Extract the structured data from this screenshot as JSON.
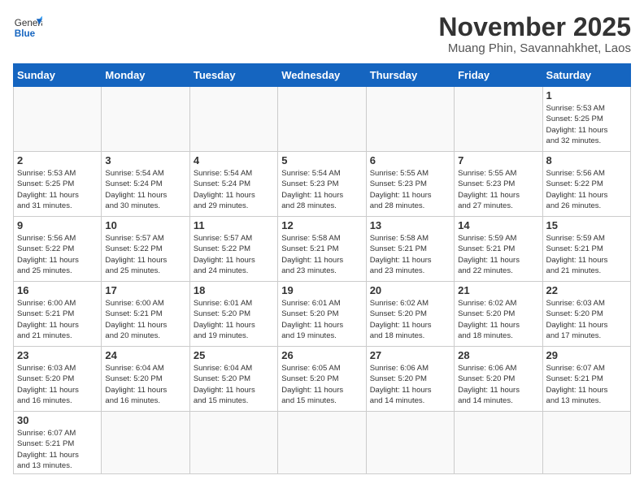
{
  "header": {
    "logo_general": "General",
    "logo_blue": "Blue",
    "month_title": "November 2025",
    "location": "Muang Phin, Savannahkhet, Laos"
  },
  "weekdays": [
    "Sunday",
    "Monday",
    "Tuesday",
    "Wednesday",
    "Thursday",
    "Friday",
    "Saturday"
  ],
  "weeks": [
    [
      {
        "day": "",
        "info": ""
      },
      {
        "day": "",
        "info": ""
      },
      {
        "day": "",
        "info": ""
      },
      {
        "day": "",
        "info": ""
      },
      {
        "day": "",
        "info": ""
      },
      {
        "day": "",
        "info": ""
      },
      {
        "day": "1",
        "info": "Sunrise: 5:53 AM\nSunset: 5:25 PM\nDaylight: 11 hours\nand 32 minutes."
      }
    ],
    [
      {
        "day": "2",
        "info": "Sunrise: 5:53 AM\nSunset: 5:25 PM\nDaylight: 11 hours\nand 31 minutes."
      },
      {
        "day": "3",
        "info": "Sunrise: 5:54 AM\nSunset: 5:24 PM\nDaylight: 11 hours\nand 30 minutes."
      },
      {
        "day": "4",
        "info": "Sunrise: 5:54 AM\nSunset: 5:24 PM\nDaylight: 11 hours\nand 29 minutes."
      },
      {
        "day": "5",
        "info": "Sunrise: 5:54 AM\nSunset: 5:23 PM\nDaylight: 11 hours\nand 28 minutes."
      },
      {
        "day": "6",
        "info": "Sunrise: 5:55 AM\nSunset: 5:23 PM\nDaylight: 11 hours\nand 28 minutes."
      },
      {
        "day": "7",
        "info": "Sunrise: 5:55 AM\nSunset: 5:23 PM\nDaylight: 11 hours\nand 27 minutes."
      },
      {
        "day": "8",
        "info": "Sunrise: 5:56 AM\nSunset: 5:22 PM\nDaylight: 11 hours\nand 26 minutes."
      }
    ],
    [
      {
        "day": "9",
        "info": "Sunrise: 5:56 AM\nSunset: 5:22 PM\nDaylight: 11 hours\nand 25 minutes."
      },
      {
        "day": "10",
        "info": "Sunrise: 5:57 AM\nSunset: 5:22 PM\nDaylight: 11 hours\nand 25 minutes."
      },
      {
        "day": "11",
        "info": "Sunrise: 5:57 AM\nSunset: 5:22 PM\nDaylight: 11 hours\nand 24 minutes."
      },
      {
        "day": "12",
        "info": "Sunrise: 5:58 AM\nSunset: 5:21 PM\nDaylight: 11 hours\nand 23 minutes."
      },
      {
        "day": "13",
        "info": "Sunrise: 5:58 AM\nSunset: 5:21 PM\nDaylight: 11 hours\nand 23 minutes."
      },
      {
        "day": "14",
        "info": "Sunrise: 5:59 AM\nSunset: 5:21 PM\nDaylight: 11 hours\nand 22 minutes."
      },
      {
        "day": "15",
        "info": "Sunrise: 5:59 AM\nSunset: 5:21 PM\nDaylight: 11 hours\nand 21 minutes."
      }
    ],
    [
      {
        "day": "16",
        "info": "Sunrise: 6:00 AM\nSunset: 5:21 PM\nDaylight: 11 hours\nand 21 minutes."
      },
      {
        "day": "17",
        "info": "Sunrise: 6:00 AM\nSunset: 5:21 PM\nDaylight: 11 hours\nand 20 minutes."
      },
      {
        "day": "18",
        "info": "Sunrise: 6:01 AM\nSunset: 5:20 PM\nDaylight: 11 hours\nand 19 minutes."
      },
      {
        "day": "19",
        "info": "Sunrise: 6:01 AM\nSunset: 5:20 PM\nDaylight: 11 hours\nand 19 minutes."
      },
      {
        "day": "20",
        "info": "Sunrise: 6:02 AM\nSunset: 5:20 PM\nDaylight: 11 hours\nand 18 minutes."
      },
      {
        "day": "21",
        "info": "Sunrise: 6:02 AM\nSunset: 5:20 PM\nDaylight: 11 hours\nand 18 minutes."
      },
      {
        "day": "22",
        "info": "Sunrise: 6:03 AM\nSunset: 5:20 PM\nDaylight: 11 hours\nand 17 minutes."
      }
    ],
    [
      {
        "day": "23",
        "info": "Sunrise: 6:03 AM\nSunset: 5:20 PM\nDaylight: 11 hours\nand 16 minutes."
      },
      {
        "day": "24",
        "info": "Sunrise: 6:04 AM\nSunset: 5:20 PM\nDaylight: 11 hours\nand 16 minutes."
      },
      {
        "day": "25",
        "info": "Sunrise: 6:04 AM\nSunset: 5:20 PM\nDaylight: 11 hours\nand 15 minutes."
      },
      {
        "day": "26",
        "info": "Sunrise: 6:05 AM\nSunset: 5:20 PM\nDaylight: 11 hours\nand 15 minutes."
      },
      {
        "day": "27",
        "info": "Sunrise: 6:06 AM\nSunset: 5:20 PM\nDaylight: 11 hours\nand 14 minutes."
      },
      {
        "day": "28",
        "info": "Sunrise: 6:06 AM\nSunset: 5:20 PM\nDaylight: 11 hours\nand 14 minutes."
      },
      {
        "day": "29",
        "info": "Sunrise: 6:07 AM\nSunset: 5:21 PM\nDaylight: 11 hours\nand 13 minutes."
      }
    ],
    [
      {
        "day": "30",
        "info": "Sunrise: 6:07 AM\nSunset: 5:21 PM\nDaylight: 11 hours\nand 13 minutes."
      },
      {
        "day": "",
        "info": ""
      },
      {
        "day": "",
        "info": ""
      },
      {
        "day": "",
        "info": ""
      },
      {
        "day": "",
        "info": ""
      },
      {
        "day": "",
        "info": ""
      },
      {
        "day": "",
        "info": ""
      }
    ]
  ]
}
